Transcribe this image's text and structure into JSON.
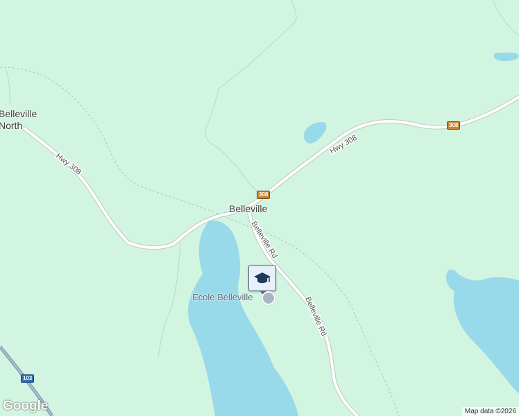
{
  "map": {
    "place_labels": {
      "belleville": "Belleville",
      "belleville_north_line1": "Belleville",
      "belleville_north_line2": "North"
    },
    "road_labels": {
      "hwy308_west": "Hwy 308",
      "hwy308_east": "Hwy 308",
      "belleville_rd_1": "Belleville Rd",
      "belleville_rd_2": "Belleville Rd"
    },
    "route_shields": {
      "shield_308_a": "308",
      "shield_308_b": "308",
      "shield_103": "103"
    },
    "poi": {
      "name": "École Belleville",
      "type_icon": "school-graduation-cap-icon"
    },
    "attribution": "Map data ©2026",
    "logo": "Google",
    "colors": {
      "land": "#d1f5e0",
      "water": "#98d9ea",
      "road": "#ffffff",
      "highway_103": "#8aa1b8"
    }
  }
}
